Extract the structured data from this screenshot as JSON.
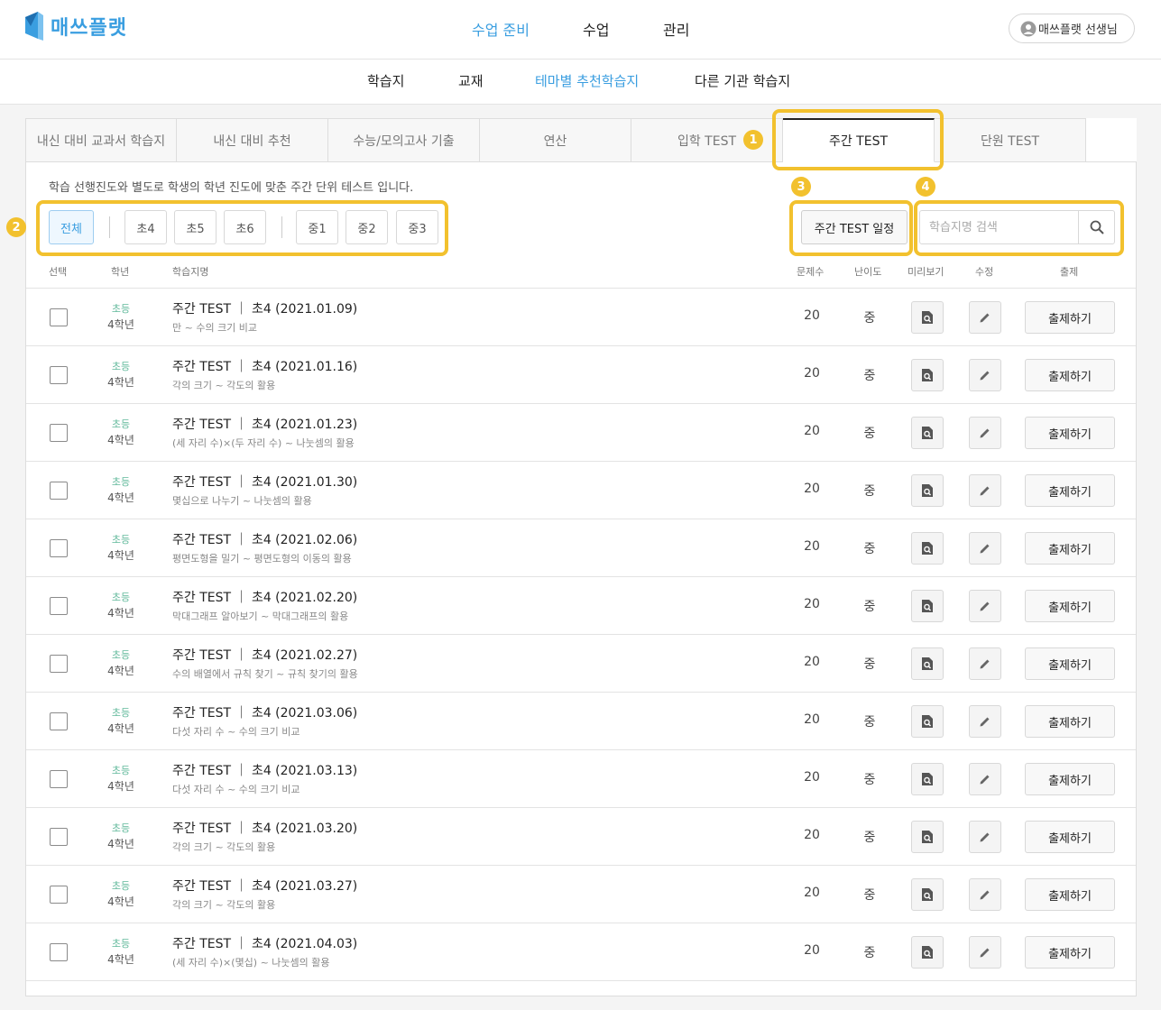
{
  "header": {
    "logo_text": "매쓰플랫",
    "nav": [
      {
        "label": "수업 준비",
        "active": true
      },
      {
        "label": "수업",
        "active": false
      },
      {
        "label": "관리",
        "active": false
      }
    ],
    "user_label": "매쓰플랫 선생님"
  },
  "subnav": [
    {
      "label": "학습지",
      "active": false
    },
    {
      "label": "교재",
      "active": false
    },
    {
      "label": "테마별 추천학습지",
      "active": true
    },
    {
      "label": "다른 기관 학습지",
      "active": false
    }
  ],
  "tabs": [
    {
      "label": "내신 대비 교과서 학습지",
      "active": false
    },
    {
      "label": "내신 대비 추천",
      "active": false
    },
    {
      "label": "수능/모의고사 기출",
      "active": false
    },
    {
      "label": "연산",
      "active": false
    },
    {
      "label": "입학 TEST",
      "active": false
    },
    {
      "label": "주간 TEST",
      "active": true
    },
    {
      "label": "단원 TEST",
      "active": false
    }
  ],
  "description": "학습 선행진도와 별도로 학생의 학년 진도에 맞춘 주간 단위 테스트 입니다.",
  "grade_filters": [
    {
      "label": "전체",
      "active": true
    },
    {
      "label": "초4",
      "active": false
    },
    {
      "label": "초5",
      "active": false
    },
    {
      "label": "초6",
      "active": false
    },
    {
      "label": "중1",
      "active": false
    },
    {
      "label": "중2",
      "active": false
    },
    {
      "label": "중3",
      "active": false
    }
  ],
  "schedule_button": "주간 TEST 일정",
  "search": {
    "placeholder": "학습지명 검색",
    "value": ""
  },
  "annotations": [
    "1",
    "2",
    "3",
    "4"
  ],
  "annotation_color": "#f2c12e",
  "accent_color": "#3a9ee0",
  "table": {
    "headers": {
      "select": "선택",
      "grade": "학년",
      "name": "학습지명",
      "count": "문제수",
      "difficulty": "난이도",
      "preview": "미리보기",
      "edit": "수정",
      "issue": "출제"
    },
    "rows": [
      {
        "level": "초등",
        "grade": "4학년",
        "title": "주간 TEST ｜ 초4 (2021.01.09)",
        "subtitle": "만 ~ 수의 크기 비교",
        "count": "20",
        "difficulty": "중",
        "issue_label": "출제하기"
      },
      {
        "level": "초등",
        "grade": "4학년",
        "title": "주간 TEST ｜ 초4 (2021.01.16)",
        "subtitle": "각의 크기 ~ 각도의 활용",
        "count": "20",
        "difficulty": "중",
        "issue_label": "출제하기"
      },
      {
        "level": "초등",
        "grade": "4학년",
        "title": "주간 TEST ｜ 초4 (2021.01.23)",
        "subtitle": "(세 자리 수)×(두 자리 수) ~ 나눗셈의 활용",
        "count": "20",
        "difficulty": "중",
        "issue_label": "출제하기"
      },
      {
        "level": "초등",
        "grade": "4학년",
        "title": "주간 TEST ｜ 초4 (2021.01.30)",
        "subtitle": "몇십으로 나누기 ~ 나눗셈의 활용",
        "count": "20",
        "difficulty": "중",
        "issue_label": "출제하기"
      },
      {
        "level": "초등",
        "grade": "4학년",
        "title": "주간 TEST ｜ 초4 (2021.02.06)",
        "subtitle": "평면도형을 밀기 ~ 평면도형의 이동의 활용",
        "count": "20",
        "difficulty": "중",
        "issue_label": "출제하기"
      },
      {
        "level": "초등",
        "grade": "4학년",
        "title": "주간 TEST ｜ 초4 (2021.02.20)",
        "subtitle": "막대그래프 알아보기 ~ 막대그래프의 활용",
        "count": "20",
        "difficulty": "중",
        "issue_label": "출제하기"
      },
      {
        "level": "초등",
        "grade": "4학년",
        "title": "주간 TEST ｜ 초4 (2021.02.27)",
        "subtitle": "수의 배열에서 규칙 찾기 ~ 규칙 찾기의 활용",
        "count": "20",
        "difficulty": "중",
        "issue_label": "출제하기"
      },
      {
        "level": "초등",
        "grade": "4학년",
        "title": "주간 TEST ｜ 초4 (2021.03.06)",
        "subtitle": "다섯 자리 수 ~ 수의 크기 비교",
        "count": "20",
        "difficulty": "중",
        "issue_label": "출제하기"
      },
      {
        "level": "초등",
        "grade": "4학년",
        "title": "주간 TEST ｜ 초4 (2021.03.13)",
        "subtitle": "다섯 자리 수 ~ 수의 크기 비교",
        "count": "20",
        "difficulty": "중",
        "issue_label": "출제하기"
      },
      {
        "level": "초등",
        "grade": "4학년",
        "title": "주간 TEST ｜ 초4 (2021.03.20)",
        "subtitle": "각의 크기 ~ 각도의 활용",
        "count": "20",
        "difficulty": "중",
        "issue_label": "출제하기"
      },
      {
        "level": "초등",
        "grade": "4학년",
        "title": "주간 TEST ｜ 초4 (2021.03.27)",
        "subtitle": "각의 크기 ~ 각도의 활용",
        "count": "20",
        "difficulty": "중",
        "issue_label": "출제하기"
      },
      {
        "level": "초등",
        "grade": "4학년",
        "title": "주간 TEST ｜ 초4 (2021.04.03)",
        "subtitle": "(세 자리 수)×(몇십) ~ 나눗셈의 활용",
        "count": "20",
        "difficulty": "중",
        "issue_label": "출제하기"
      }
    ]
  }
}
